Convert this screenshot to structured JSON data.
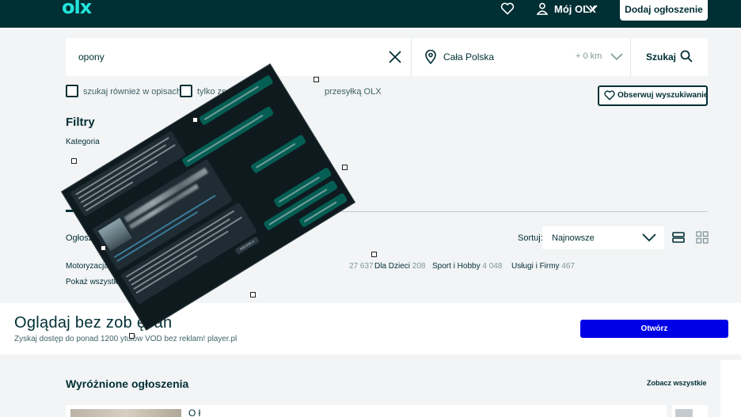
{
  "header": {
    "logo": "olx",
    "my_olx_label": "Mój OLX",
    "add_listing_label": "Dodaj ogłoszenie"
  },
  "search": {
    "query": "opony",
    "location": "Cała Polska",
    "radius": "+ 0 km",
    "search_button": "Szukaj"
  },
  "options": {
    "in_descriptions": "szukaj również w opisach",
    "with_photo": "tylko ze zdjęciem",
    "with_shipping": "przesyłką OLX",
    "observe_search": "Obserwuj wyszukiwanie"
  },
  "filters": {
    "title": "Filtry",
    "category_label": "Kategoria"
  },
  "results": {
    "ogloszenia_label": "Ogłoszenia",
    "sort_label": "Sortuj:",
    "sort_value": "Najnowsze",
    "categories": [
      {
        "name": "Motoryzacja",
        "count": ""
      },
      {
        "name": "",
        "count": "27 637"
      },
      {
        "name": "Dla Dzieci",
        "count": "208"
      },
      {
        "name": "Sport i Hobby",
        "count": "4 048"
      },
      {
        "name": "Usługi i Firmy",
        "count": "467"
      }
    ],
    "show_all": "Pokaż wszystk"
  },
  "banner": {
    "title": "Oglądaj bez zob     ęcan",
    "subtitle": "Zyskaj dostęp do ponad 1200      ytułów VOD bez reklam! player.pl",
    "button": "Otwórz"
  },
  "featured": {
    "title": "Wyróżnione ogłoszenia",
    "see_all": "Zobacz wszystkie",
    "card_title": "O     ł"
  },
  "overlay": {
    "label_snippet": "NIEDZIELA"
  },
  "colors": {
    "header_bg": "#002f34",
    "logo": "#23e5db",
    "primary_button": "#0000e6",
    "page_bg": "#f2f4f5"
  }
}
